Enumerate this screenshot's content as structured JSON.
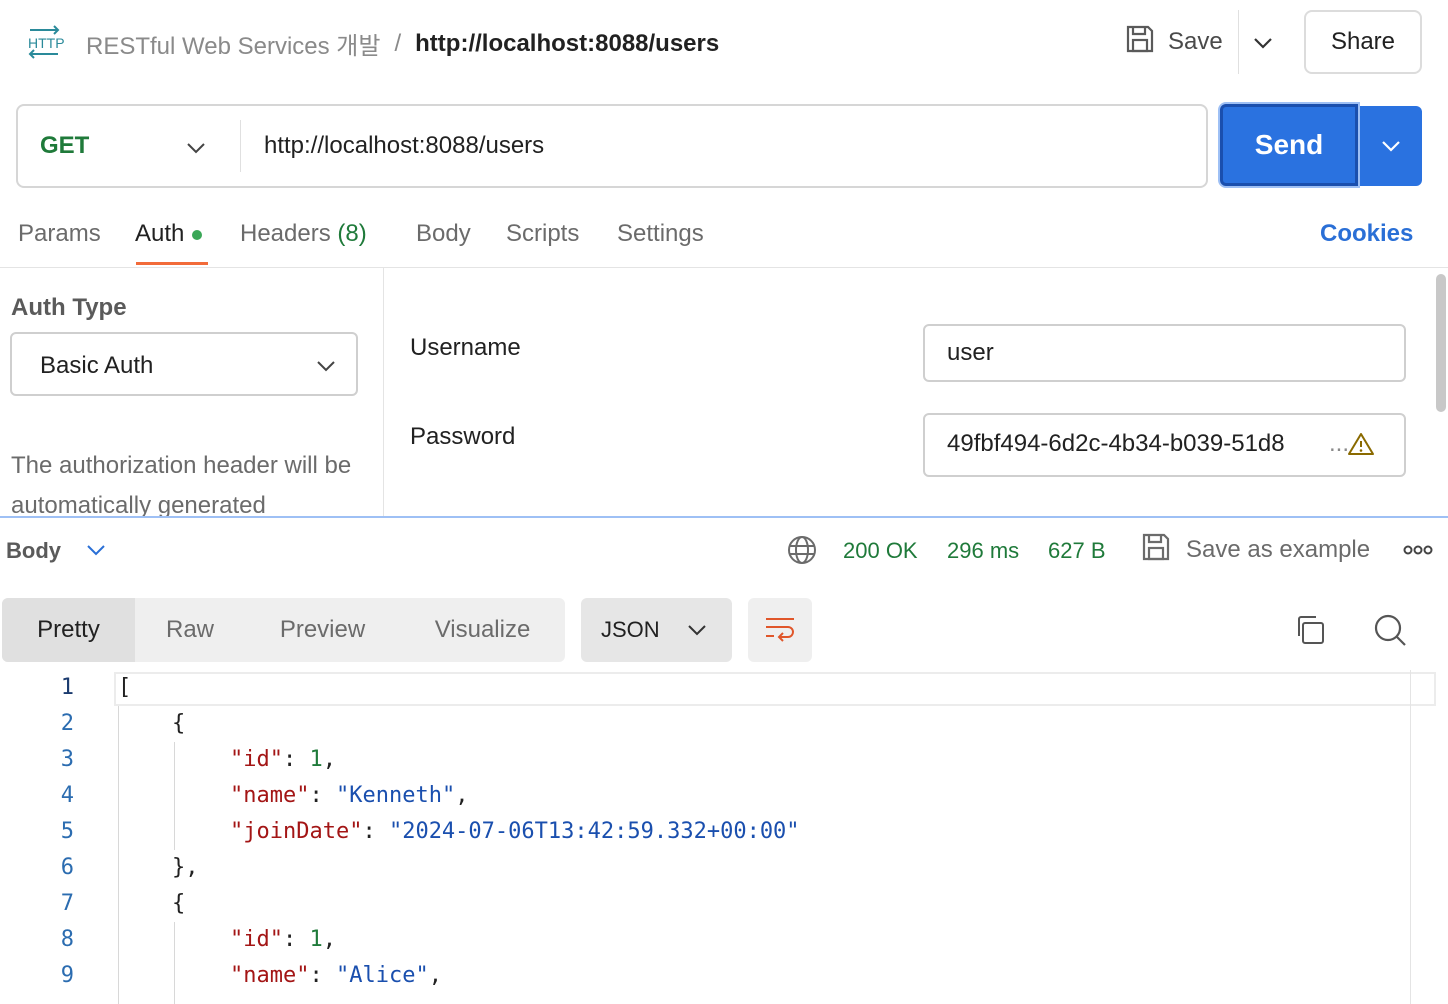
{
  "header": {
    "collection": "RESTful Web Services 개발",
    "separator": "/",
    "request_name": "http://localhost:8088/users",
    "save_label": "Save",
    "share_label": "Share",
    "http_icon": "http-icon"
  },
  "request": {
    "method": "GET",
    "url": "http://localhost:8088/users",
    "send_label": "Send"
  },
  "tabs": {
    "params": "Params",
    "auth": "Auth",
    "headers": "Headers",
    "headers_count": "(8)",
    "body": "Body",
    "scripts": "Scripts",
    "settings": "Settings",
    "active": "Auth",
    "cookies": "Cookies"
  },
  "auth": {
    "type_label": "Auth Type",
    "type_value": "Basic Auth",
    "description": "The authorization header will be automatically generated",
    "username_label": "Username",
    "username_value": "user",
    "password_label": "Password",
    "password_value": "49fbf494-6d2c-4b34-b039-51d8",
    "password_ellipsis": "..."
  },
  "response": {
    "body_label": "Body",
    "status": "200 OK",
    "time": "296 ms",
    "size": "627 B",
    "save_example_label": "Save as example",
    "status_color": "#1f7a3a"
  },
  "view": {
    "tabs": [
      "Pretty",
      "Raw",
      "Preview",
      "Visualize"
    ],
    "active_tab": "Pretty",
    "format": "JSON"
  },
  "code_lines": [
    "1",
    "2",
    "3",
    "4",
    "5",
    "6",
    "7",
    "8",
    "9"
  ],
  "json": {
    "open_bracket": "[",
    "open_brace": "{",
    "close_brace": "},",
    "k_id": "\"id\"",
    "k_name": "\"name\"",
    "k_joinDate": "\"joinDate\"",
    "user1_id": "1",
    "user1_name": "\"Kenneth\"",
    "user1_joinDate": "\"2024-07-06T13:42:59.332+00:00\"",
    "user2_id": "1",
    "user2_name": "\"Alice\""
  },
  "colors": {
    "accent": "#2a72e0",
    "method": "#1f7a3a",
    "tab_underline": "#f26b3a",
    "link": "#2a6fd6"
  }
}
